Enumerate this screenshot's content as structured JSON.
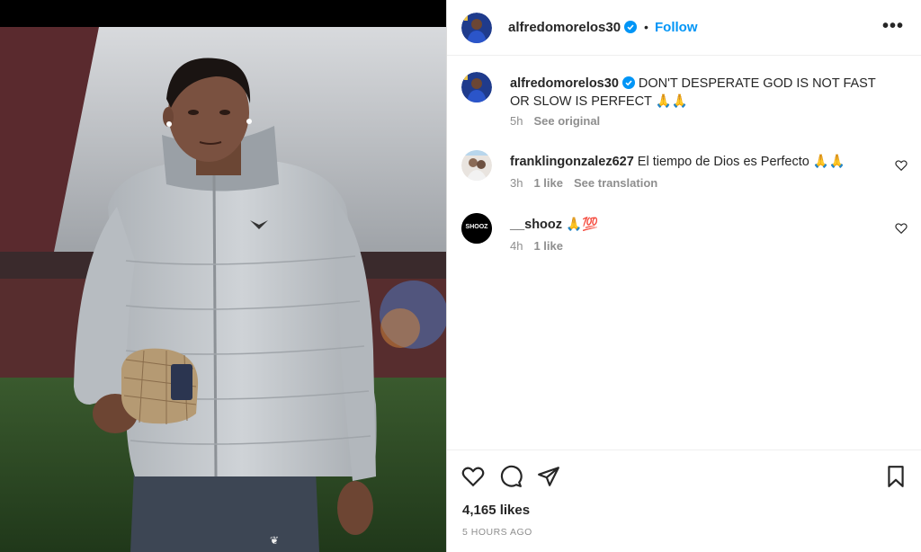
{
  "post": {
    "author": "alfredomorelos30",
    "follow_label": "Follow",
    "dot": "•",
    "more_label": "•••"
  },
  "caption": {
    "username": "alfredomorelos30",
    "text": "DON'T DESPERATE GOD IS NOT FAST OR SLOW IS PERFECT",
    "emoji": "🙏🙏",
    "time": "5h",
    "see_original": "See original"
  },
  "comments": [
    {
      "username": "franklingonzalez627",
      "text": "El tiempo de Dios es Perfecto",
      "emoji": "🙏🙏",
      "time": "3h",
      "likes": "1 like",
      "see_translation": "See translation"
    },
    {
      "username": "__shooz",
      "text": "",
      "emoji": "🙏💯",
      "time": "4h",
      "likes": "1 like",
      "avatar_text": "SHOOZ"
    }
  ],
  "footer": {
    "likes": "4,165 likes",
    "time_ago": "5 HOURS AGO"
  },
  "icons": [
    "heart-icon",
    "comment-icon",
    "share-icon",
    "bookmark-icon",
    "verified-icon",
    "more-icon"
  ],
  "colors": {
    "accent": "#0095f6",
    "text": "#262626",
    "muted": "#8e8e8e",
    "jacket": "#c4c8cc"
  }
}
